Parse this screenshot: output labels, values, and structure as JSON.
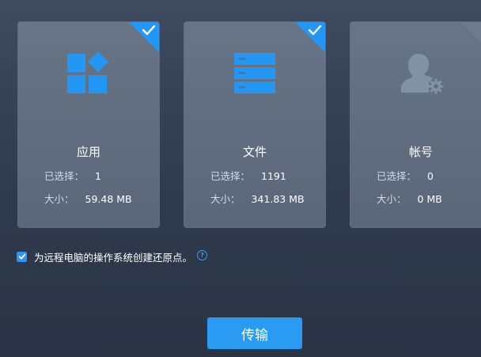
{
  "colors": {
    "accent": "#2b9af3",
    "icon_blue": "#2496f3",
    "icon_gray": "#8391a5",
    "card_bg": "#627083"
  },
  "cards": [
    {
      "title": "应用",
      "icon": "apps-icon",
      "selected": true,
      "selected_label": "已选择：",
      "selected_value": "1",
      "size_label": "大小：",
      "size_value": "59.48 MB"
    },
    {
      "title": "文件",
      "icon": "file-stack-icon",
      "selected": true,
      "selected_label": "已选择：",
      "selected_value": "1191",
      "size_label": "大小：",
      "size_value": "341.83 MB"
    },
    {
      "title": "帐号",
      "icon": "user-settings-icon",
      "selected": false,
      "selected_label": "已选择：",
      "selected_value": "0",
      "size_label": "大小：",
      "size_value": "0 MB"
    }
  ],
  "restore_point": {
    "checked": true,
    "label": "为远程电脑的操作系统创建还原点。",
    "help_icon": "help-icon",
    "help_glyph": "?"
  },
  "transfer_button": {
    "label": "传输"
  }
}
